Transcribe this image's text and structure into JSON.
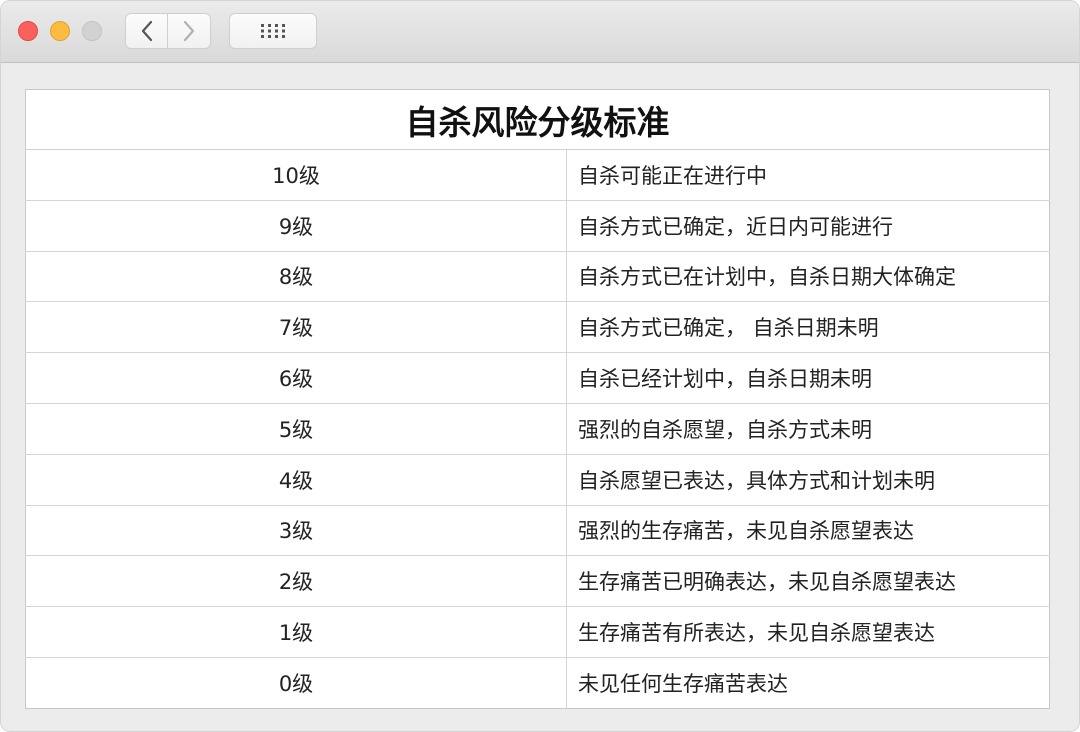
{
  "window": {
    "traffic_lights": [
      "close",
      "minimize",
      "zoom"
    ],
    "nav": {
      "back_icon": "chevron-left-icon",
      "forward_icon": "chevron-right-icon",
      "grid_icon": "grid-icon"
    }
  },
  "table": {
    "title": "自杀风险分级标准",
    "rows": [
      {
        "level": "10级",
        "description": "自杀可能正在进行中"
      },
      {
        "level": "9级",
        "description": "自杀方式已确定，近日内可能进行"
      },
      {
        "level": "8级",
        "description": "自杀方式已在计划中，自杀日期大体确定"
      },
      {
        "level": "7级",
        "description": "自杀方式已确定， 自杀日期未明"
      },
      {
        "level": "6级",
        "description": "自杀已经计划中，自杀日期未明"
      },
      {
        "level": "5级",
        "description": "强烈的自杀愿望，自杀方式未明"
      },
      {
        "level": "4级",
        "description": "自杀愿望已表达，具体方式和计划未明"
      },
      {
        "level": "3级",
        "description": "强烈的生存痛苦，未见自杀愿望表达"
      },
      {
        "level": "2级",
        "description": "生存痛苦已明确表达，未见自杀愿望表达"
      },
      {
        "level": "1级",
        "description": "生存痛苦有所表达，未见自杀愿望表达"
      },
      {
        "level": "0级",
        "description": "未见任何生存痛苦表达"
      }
    ]
  }
}
